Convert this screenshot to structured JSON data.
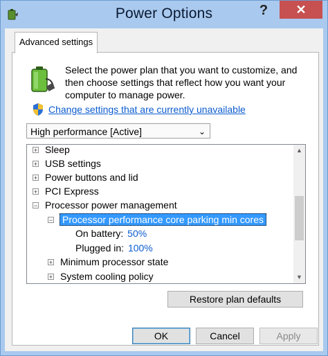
{
  "window": {
    "title": "Power Options",
    "help_label": "?",
    "close_label": "✕"
  },
  "tab": {
    "label": "Advanced settings"
  },
  "intro_text": "Select the power plan that you want to customize, and then choose settings that reflect how you want your computer to manage power.",
  "change_settings_link": "Change settings that are currently unavailable",
  "plan_select": {
    "selected": "High performance [Active]",
    "arrow": "⌄"
  },
  "tree": {
    "sleep": {
      "toggle": "+",
      "label": "Sleep"
    },
    "usb": {
      "toggle": "+",
      "label": "USB settings"
    },
    "power_buttons": {
      "toggle": "+",
      "label": "Power buttons and lid"
    },
    "pci": {
      "toggle": "+",
      "label": "PCI Express"
    },
    "processor": {
      "toggle": "−",
      "label": "Processor power management"
    },
    "core_parking": {
      "toggle": "−",
      "label": "Processor performance core parking min cores"
    },
    "on_battery": {
      "label": "On battery:",
      "value": "50%"
    },
    "plugged_in": {
      "label": "Plugged in:",
      "value": "100%"
    },
    "min_state": {
      "toggle": "+",
      "label": "Minimum processor state"
    },
    "cooling": {
      "toggle": "+",
      "label": "System cooling policy"
    }
  },
  "buttons": {
    "restore": "Restore plan defaults",
    "ok": "OK",
    "cancel": "Cancel",
    "apply": "Apply"
  },
  "colors": {
    "titlebar": "#a9c9ee",
    "close": "#c75050",
    "link": "#0b5ccf",
    "selection": "#3399ff"
  }
}
